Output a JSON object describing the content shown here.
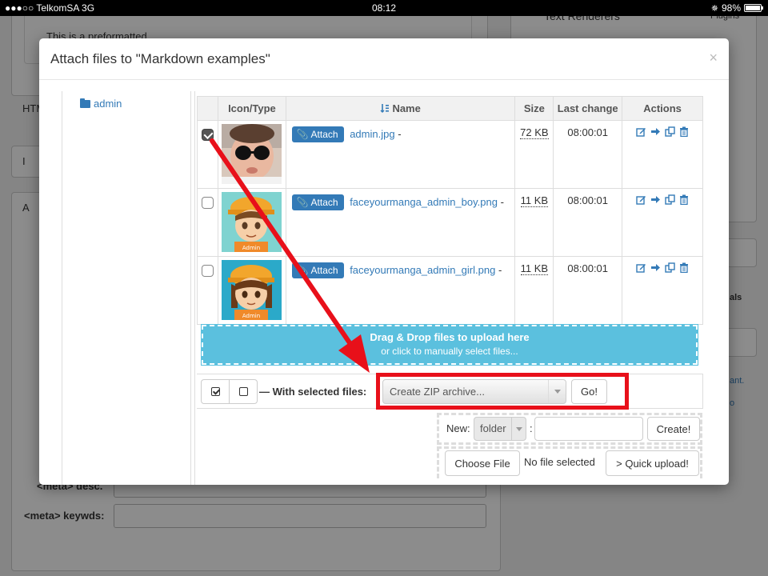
{
  "status_bar": {
    "carrier": "●●●○○ TelkomSA   3G",
    "time": "08:12",
    "battery": "98%",
    "battery_level": 0.98
  },
  "background_page": {
    "preformatted_text": "This is a preformatted",
    "header_right": "Text Renderers",
    "plugins": "Plugins",
    "htm_label": "HTM",
    "side_label_1": "I",
    "side_label_2": "A",
    "meta_desc_label": "<meta> desc.",
    "meta_keywds_label": "<meta> keywds:",
    "right_text_1": "als",
    "right_text_2": "ant.",
    "right_text_3": "o"
  },
  "modal": {
    "title": "Attach files to \"Markdown examples\"",
    "close": "×",
    "tree": {
      "root_label": "admin"
    },
    "table": {
      "headers": {
        "icon_type": "Icon/Type",
        "name": "Name",
        "size": "Size",
        "last_change": "Last change",
        "actions": "Actions"
      },
      "rows": [
        {
          "checked": true,
          "attach_label": "Attach",
          "filename": "admin.jpg",
          "dash": "-",
          "size": "72 KB",
          "time": "08:00:01"
        },
        {
          "checked": false,
          "attach_label": "Attach",
          "filename": "faceyourmanga_admin_boy.png",
          "dash": "-",
          "size": "11 KB",
          "time": "08:00:01"
        },
        {
          "checked": false,
          "attach_label": "Attach",
          "filename": "faceyourmanga_admin_girl.png",
          "dash": "-",
          "size": "11 KB",
          "time": "08:00:01"
        }
      ],
      "thumb_badge": "Admin"
    },
    "dropzone": {
      "title": "Drag & Drop files to upload here",
      "subtitle": "or click to manually select files..."
    },
    "selection": {
      "label": "— With selected files:",
      "action_value": "Create ZIP archive...",
      "go_label": "Go!"
    },
    "new_item": {
      "label": "New:",
      "type_value": "folder",
      "colon": ":",
      "name_value": "",
      "create_label": "Create!"
    },
    "upload": {
      "choose_label": "Choose File",
      "no_file_text": "No file selected",
      "quick_upload_label": "> Quick upload!"
    }
  },
  "annotation": {
    "highlight_color": "#e8101a"
  },
  "colors": {
    "link": "#337ab7",
    "dropzone": "#5bc0de"
  }
}
